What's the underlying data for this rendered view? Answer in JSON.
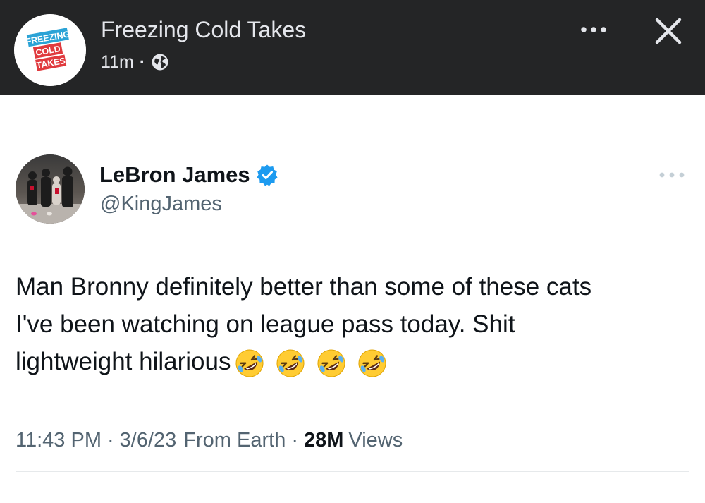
{
  "header": {
    "page_name": "Freezing Cold Takes",
    "time_ago": "11m",
    "separator": "·",
    "logo_lines": [
      "FREEZING",
      "COLD",
      "TAKES"
    ],
    "visibility_icon": "globe-icon",
    "more_icon": "more-horizontal-icon",
    "close_icon": "close-icon"
  },
  "tweet": {
    "author_name": "LeBron James",
    "handle": "@KingJames",
    "verified_icon": "verified-badge-icon",
    "text_lines": [
      "Man Bronny definitely better than some of these cats",
      "I've been watching on league pass today.  Shit",
      "lightweight hilarious"
    ],
    "emojis": [
      "rolling-on-floor-laughing",
      "rolling-on-floor-laughing",
      "rolling-on-floor-laughing",
      "rolling-on-floor-laughing"
    ],
    "time": "11:43 PM",
    "date": "3/6/23",
    "source": "From Earth",
    "dot": "·",
    "views_count": "28M",
    "views_label": "Views"
  },
  "colors": {
    "header_bg": "#242526",
    "header_text": "#e4e6eb",
    "text_primary": "#0f1419",
    "text_secondary": "#536471",
    "verified_blue": "#1d9bf0",
    "logo_red": "#e03a3e",
    "logo_blue": "#2ba3d6"
  }
}
